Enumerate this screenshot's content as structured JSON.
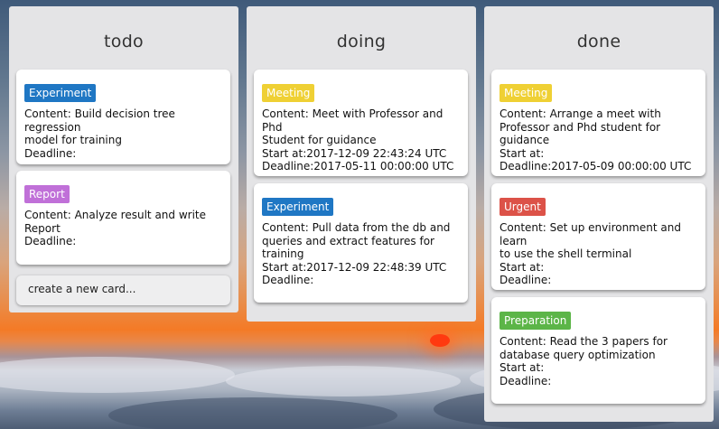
{
  "columns": [
    {
      "title": "todo",
      "cards": [
        {
          "badge": "Experiment",
          "badge_color": "#1f77c4",
          "lines": [
            "Content: Build decision tree regression",
            "model for training",
            "Deadline:"
          ]
        },
        {
          "badge": "Report",
          "badge_color": "#c070d8",
          "lines": [
            "Content: Analyze result and write",
            "Report",
            "Deadline:"
          ]
        }
      ],
      "new_card_label": "create a new card..."
    },
    {
      "title": "doing",
      "cards": [
        {
          "badge": "Meeting",
          "badge_color": "#efd034",
          "lines": [
            "Content: Meet with Professor and Phd",
            "Student for guidance",
            "Start at:2017-12-09 22:43:24 UTC",
            "Deadline:2017-05-11 00:00:00 UTC"
          ]
        },
        {
          "badge": "Experiment",
          "badge_color": "#1f77c4",
          "lines": [
            "Content: Pull data from the db and",
            "queries and extract features for",
            "training",
            "Start at:2017-12-09 22:48:39 UTC",
            "Deadline:"
          ]
        }
      ]
    },
    {
      "title": "done",
      "cards": [
        {
          "badge": "Meeting",
          "badge_color": "#efd034",
          "lines": [
            "Content: Arrange a meet with",
            "Professor and Phd student for guidance",
            "Start at:",
            "Deadline:2017-05-09 00:00:00 UTC"
          ]
        },
        {
          "badge": "Urgent",
          "badge_color": "#dc5248",
          "lines": [
            "Content: Set up environment and learn",
            "to use the shell terminal",
            "Start at:",
            "Deadline:"
          ]
        },
        {
          "badge": "Preparation",
          "badge_color": "#5cb548",
          "lines": [
            "Content: Read the 3 papers for",
            "database query optimization",
            "Start at:",
            "Deadline:"
          ]
        }
      ]
    }
  ]
}
